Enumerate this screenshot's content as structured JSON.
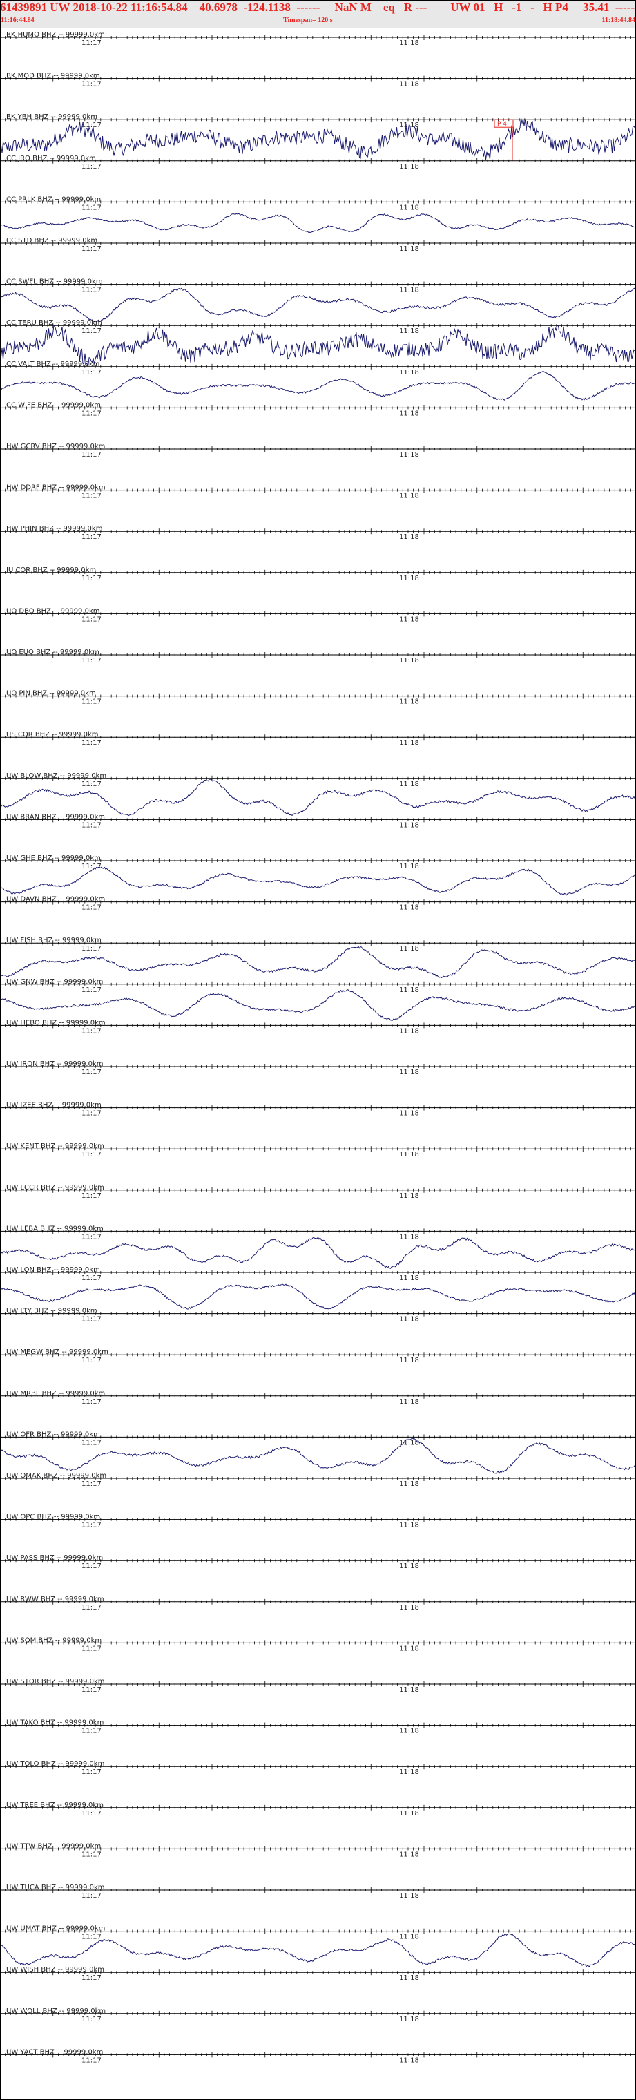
{
  "header": {
    "title": "61439891 UW 2018-10-22 11:16:54.84    40.6978  -124.1138  ------     NaN M    eq   R ---        UW 01   H   -1   -   H P4     35.41  -------",
    "time_start": "11:16:44.84",
    "timespan": "Timespan= 120 s",
    "time_end": "11:18:44.84"
  },
  "colors": {
    "header_text": "#e8231f",
    "header_bg": "#e8e8e8",
    "trace": "#1a1a6e",
    "axis": "#000000",
    "pick": "#e8231f"
  },
  "tick_labels": {
    "first": "11:17",
    "second": "11:18"
  },
  "pick_label": "P 4",
  "chart_data": {
    "type": "line",
    "x_range_seconds": [
      0,
      120
    ],
    "channels": [
      {
        "label": "BK HUMO BHZ -- 99999.0km",
        "has_trace": false
      },
      {
        "label": "BK MOD BHZ -- 99999.0km",
        "has_trace": false
      },
      {
        "label": "BK YBH BHZ -- 99999.0km",
        "has_trace": true,
        "style": "noisy",
        "amp": 24,
        "has_pick": true
      },
      {
        "label": "CC JRO BHZ -- 99999.0km",
        "has_trace": false
      },
      {
        "label": "CC PRLK BHZ -- 99999.0km",
        "has_trace": true,
        "style": "wave",
        "amp": 18
      },
      {
        "label": "CC STD BHZ -- 99999.0km",
        "has_trace": false
      },
      {
        "label": "CC SWFL BHZ -- 99999.0km",
        "has_trace": true,
        "style": "wave",
        "amp": 26
      },
      {
        "label": "CC TERU BHZ -- 99999.0km",
        "has_trace": true,
        "style": "noisy",
        "amp": 24
      },
      {
        "label": "CC VALT BHZ -- 99999.0km",
        "has_trace": true,
        "style": "wave",
        "amp": 22
      },
      {
        "label": "CC WIFE BHZ -- 99999.0km",
        "has_trace": false
      },
      {
        "label": "HW GCRV BHZ -- 99999.0km",
        "has_trace": false
      },
      {
        "label": "HW DDRF BHZ -- 99999.0km",
        "has_trace": false
      },
      {
        "label": "HW PHIN BHZ -- 99999.0km",
        "has_trace": false
      },
      {
        "label": "IU COR BHZ -- 99999.0km",
        "has_trace": false
      },
      {
        "label": "UO DBO BHZ -- 99999.0km",
        "has_trace": false
      },
      {
        "label": "UO EUO BHZ -- 99999.0km",
        "has_trace": false
      },
      {
        "label": "UO PIN BHZ -- 99999.0km",
        "has_trace": false
      },
      {
        "label": "US COR BHZ -- 99999.0km",
        "has_trace": false
      },
      {
        "label": "UW BLOW BHZ -- 99999.0km",
        "has_trace": true,
        "style": "wave",
        "amp": 28
      },
      {
        "label": "UW BRAN BHZ -- 99999.0km",
        "has_trace": false
      },
      {
        "label": "UW GHE BHZ -- 99999.0km",
        "has_trace": true,
        "style": "wave",
        "amp": 22
      },
      {
        "label": "UW DAVN BHZ -- 99999.0km",
        "has_trace": false
      },
      {
        "label": "UW FISH BHZ -- 99999.0km",
        "has_trace": true,
        "style": "wave",
        "amp": 26
      },
      {
        "label": "UW GNW BHZ -- 99999.0km",
        "has_trace": true,
        "style": "wave",
        "amp": 24
      },
      {
        "label": "UW HEBO BHZ -- 99999.0km",
        "has_trace": false
      },
      {
        "label": "UW IRON BHZ -- 99999.0km",
        "has_trace": false
      },
      {
        "label": "UW JZEE BHZ -- 99999.0km",
        "has_trace": false
      },
      {
        "label": "UW KENT BHZ -- 99999.0km",
        "has_trace": false
      },
      {
        "label": "UW LCCR BHZ -- 99999.0km",
        "has_trace": false
      },
      {
        "label": "UW LEBA BHZ -- 99999.0km",
        "has_trace": true,
        "style": "wave",
        "amp": 26
      },
      {
        "label": "UW LON BHZ -- 99999.0km",
        "has_trace": true,
        "style": "wave",
        "amp": 24
      },
      {
        "label": "UW LTY BHZ -- 99999.0km",
        "has_trace": false
      },
      {
        "label": "UW MEGW BHZ -- 99999.0km",
        "has_trace": false
      },
      {
        "label": "UW MRBL BHZ -- 99999.0km",
        "has_trace": false
      },
      {
        "label": "UW OFR BHZ -- 99999.0km",
        "has_trace": true,
        "style": "wave",
        "amp": 28
      },
      {
        "label": "UW OMAK BHZ -- 99999.0km",
        "has_trace": false
      },
      {
        "label": "UW OPC BHZ -- 99999.0km",
        "has_trace": false
      },
      {
        "label": "UW PASS BHZ -- 99999.0km",
        "has_trace": false
      },
      {
        "label": "UW RWW BHZ -- 99999.0km",
        "has_trace": false
      },
      {
        "label": "UW SQM BHZ -- 99999.0km",
        "has_trace": false
      },
      {
        "label": "UW STOR BHZ -- 99999.0km",
        "has_trace": false
      },
      {
        "label": "UW TAKO BHZ -- 99999.0km",
        "has_trace": false
      },
      {
        "label": "UW TOLO BHZ -- 99999.0km",
        "has_trace": false
      },
      {
        "label": "UW TREE BHZ -- 99999.0km",
        "has_trace": false
      },
      {
        "label": "UW TTW BHZ -- 99999.0km",
        "has_trace": false
      },
      {
        "label": "UW TUCA BHZ -- 99999.0km",
        "has_trace": false
      },
      {
        "label": "UW UMAT BHZ -- 99999.0km",
        "has_trace": true,
        "style": "wave",
        "amp": 26
      },
      {
        "label": "UW WISH BHZ -- 99999.0km",
        "has_trace": false
      },
      {
        "label": "UW WOLL BHZ -- 99999.0km",
        "has_trace": false
      },
      {
        "label": "UW YACT BHZ -- 99999.0km",
        "has_trace": false
      }
    ]
  }
}
